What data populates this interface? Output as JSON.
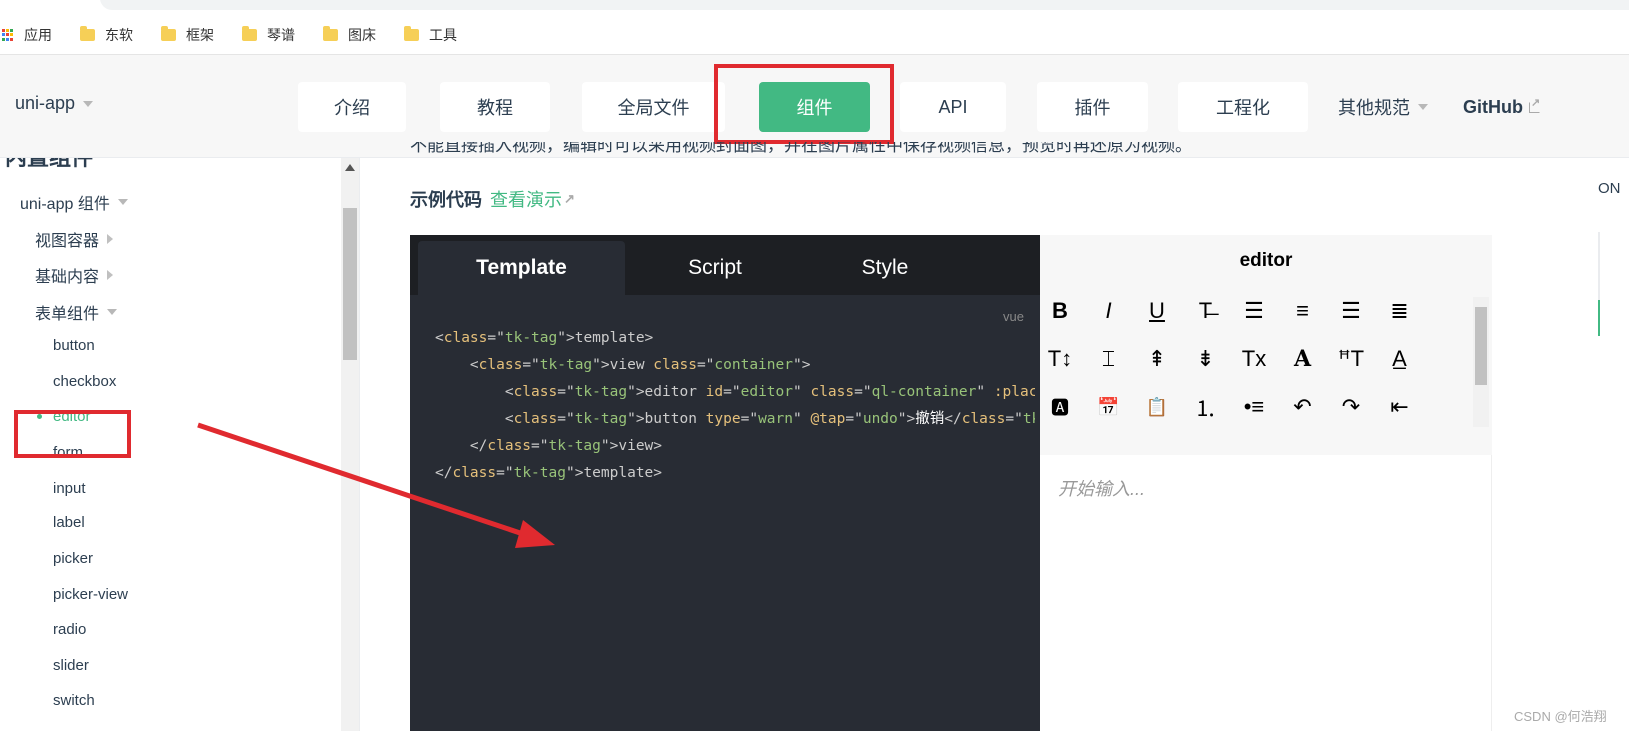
{
  "bookmarks": [
    {
      "label": "应用",
      "icon": "apps-grid-icon"
    },
    {
      "label": "东软",
      "icon": "folder-icon"
    },
    {
      "label": "框架",
      "icon": "folder-icon"
    },
    {
      "label": "琴谱",
      "icon": "folder-icon"
    },
    {
      "label": "图床",
      "icon": "folder-icon"
    },
    {
      "label": "工具",
      "icon": "folder-icon"
    }
  ],
  "nav": {
    "brand": "uni-app",
    "items": [
      "介绍",
      "教程",
      "全局文件",
      "组件",
      "API",
      "插件",
      "工程化"
    ],
    "active": "组件",
    "more": "其他规范",
    "github": "GitHub"
  },
  "sidebar": {
    "heading": "内置组件",
    "group": "uni-app 组件",
    "categories": [
      "视图容器",
      "基础内容",
      "表单组件"
    ],
    "leaves": [
      "button",
      "checkbox",
      "editor",
      "form",
      "input",
      "label",
      "picker",
      "picker-view",
      "radio",
      "slider",
      "switch"
    ],
    "active_leaf": "editor"
  },
  "content": {
    "top_text": "不能直接插入视频，编辑时可以采用视频封面图，并在图片属性中保存视频信息，预览时再还原为视频。",
    "example_title": "示例代码",
    "demo_link": "查看演示"
  },
  "code_panel": {
    "tabs": [
      "Template",
      "Script",
      "Style"
    ],
    "active_tab": "Template",
    "lang": "vue",
    "lines": [
      "<template>",
      "    <view class=\"container\">",
      "        <editor id=\"editor\" class=\"ql-container\" :placeholder=\"placeholder\"",
      "        <button type=\"warn\" @tap=\"undo\">撤销</button>",
      "    </view>",
      "</template>"
    ]
  },
  "preview": {
    "title": "editor",
    "toolbar_icons": [
      "bold-icon",
      "italic-icon",
      "underline-icon",
      "strikethrough-icon",
      "align-left-icon",
      "align-center-icon",
      "align-right-icon",
      "align-justify-icon",
      "font-size-icon",
      "text-indent-icon",
      "line-height-icon",
      "paragraph-spacing-icon",
      "clear-format-icon",
      "font-icon",
      "font-heading-icon",
      "font-color-icon",
      "background-color-icon",
      "date-icon",
      "clipboard-icon",
      "ordered-list-icon",
      "unordered-list-icon",
      "undo-icon",
      "redo-icon",
      "outdent-icon"
    ],
    "placeholder": "开始输入..."
  },
  "right_panel": {
    "label": "ON"
  },
  "watermark": "CSDN @何浩翔"
}
